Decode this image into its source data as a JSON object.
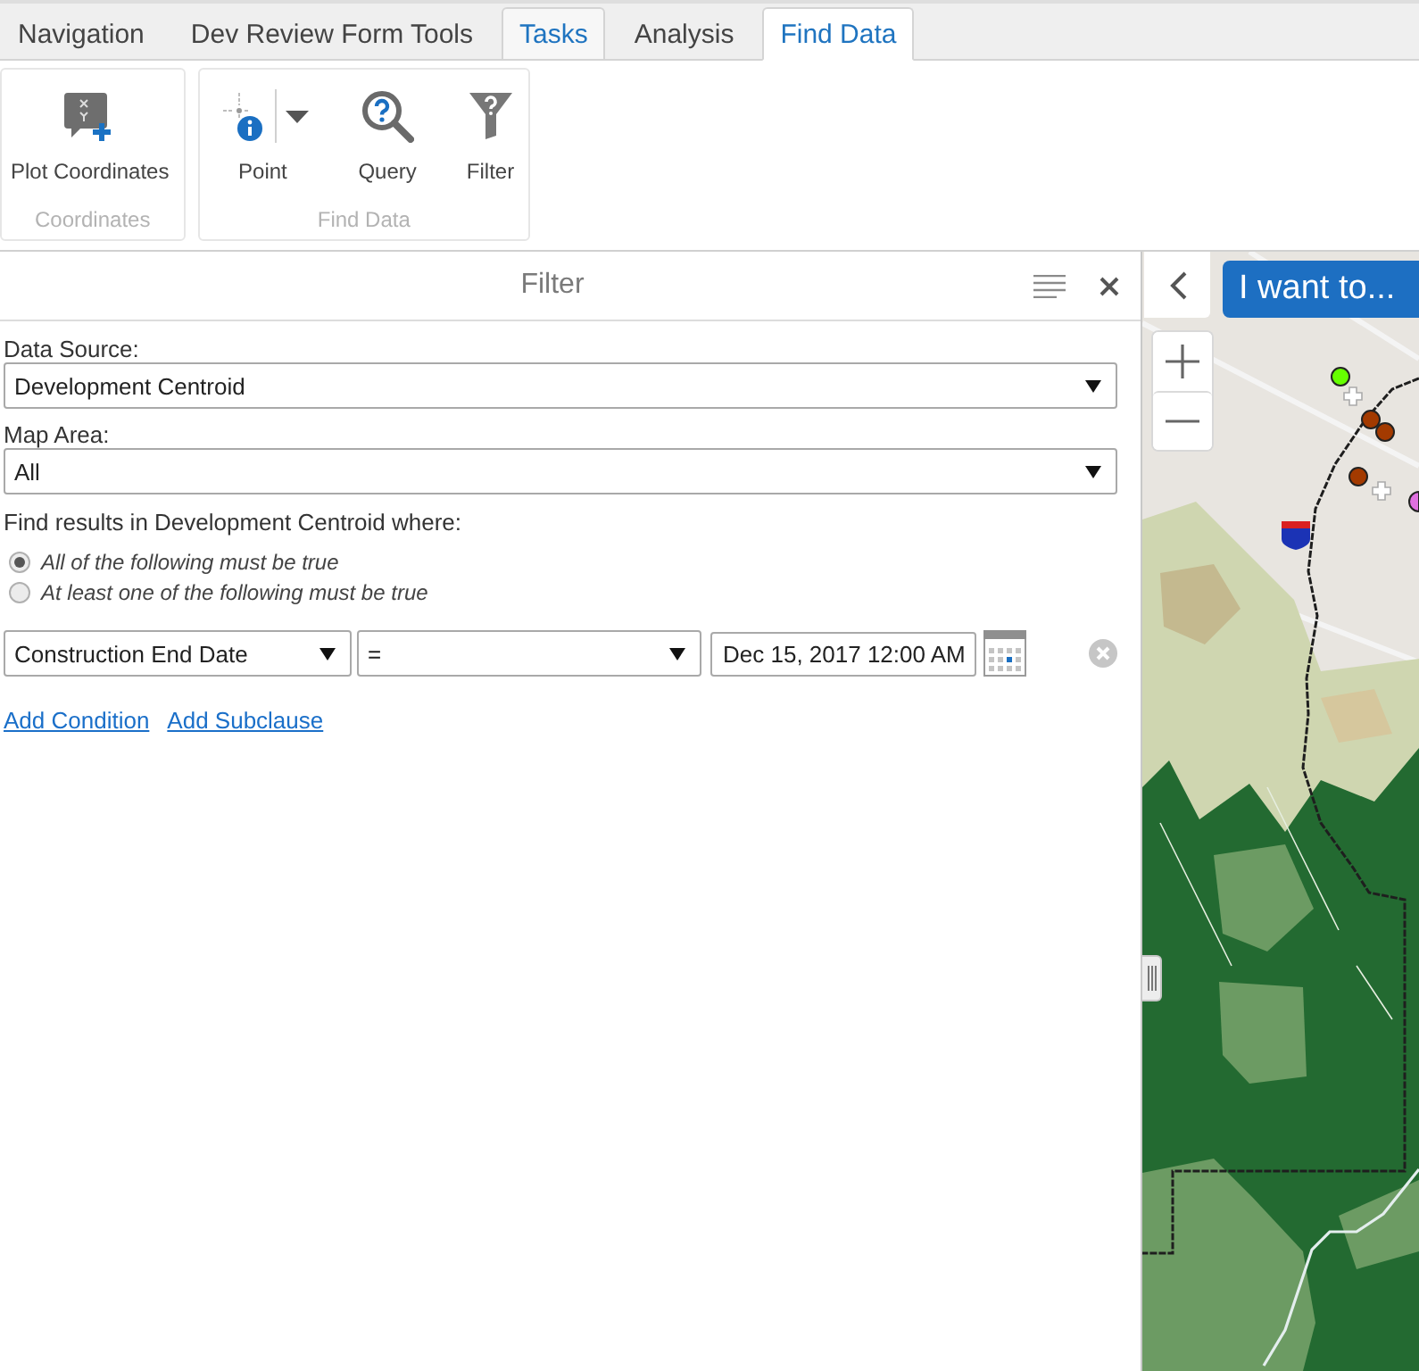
{
  "tabs": [
    {
      "label": "Navigation",
      "selected": false,
      "contextual": false
    },
    {
      "label": "Dev Review Form Tools",
      "selected": false,
      "contextual": false
    },
    {
      "label": "Tasks",
      "selected": false,
      "contextual": true
    },
    {
      "label": "Analysis",
      "selected": false,
      "contextual": false
    },
    {
      "label": "Find Data",
      "selected": true,
      "contextual": true
    }
  ],
  "ribbon": {
    "groups": [
      {
        "label": "Coordinates",
        "buttons": [
          {
            "label": "Plot Coordinates",
            "kind": "plot",
            "dropdown": false
          }
        ]
      },
      {
        "label": "Find Data",
        "buttons": [
          {
            "label": "Point",
            "kind": "point",
            "dropdown": true
          },
          {
            "label": "Query",
            "kind": "query",
            "dropdown": false
          },
          {
            "label": "Filter",
            "kind": "filter",
            "dropdown": false
          }
        ]
      }
    ]
  },
  "filter_panel": {
    "title": "Filter",
    "fields": [
      {
        "label": "Data Source:",
        "value": "Development Centroid"
      },
      {
        "label": "Map Area:",
        "value": "All"
      }
    ],
    "prompt": "Find results in Development Centroid where:",
    "match_options": [
      {
        "label": "All of the following must be true",
        "selected": true
      },
      {
        "label": "At least one of the following must be true",
        "selected": false
      }
    ],
    "conditions": [
      {
        "field": "Construction End Date",
        "operator": "=",
        "value": "Dec 15, 2017 12:00 AM"
      }
    ],
    "links": [
      "Add Condition",
      "Add Subclause"
    ]
  },
  "map": {
    "action_button": "I want to..."
  }
}
